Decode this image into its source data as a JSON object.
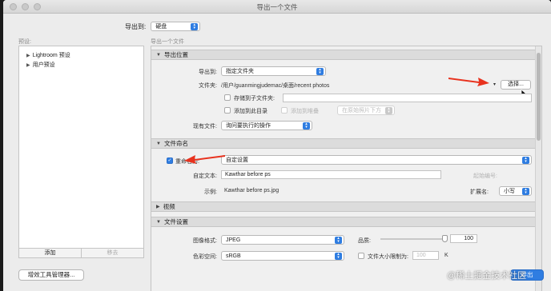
{
  "window": {
    "title": "导出一个文件"
  },
  "export_to": {
    "label": "导出到:",
    "value": "硬盘"
  },
  "presets": {
    "header": "预设:",
    "items": [
      {
        "label": "Lightroom 预设"
      },
      {
        "label": "用户预设"
      }
    ],
    "add_label": "添加",
    "remove_label": "移去"
  },
  "settings_header": "导出一个文件",
  "export_location": {
    "title": "导出位置",
    "export_to_label": "导出到:",
    "export_to_value": "指定文件夹",
    "folder_label": "文件夹:",
    "folder_path": "/用户/guanmingjudemac/桌面/recent photos",
    "choose_button": "选择...",
    "subfolder_label": "存储到子文件夹:",
    "add_to_catalog_label": "添加到此目录",
    "add_to_stack_label": "添加到堆叠",
    "stack_position": "在原始照片下方",
    "existing_files_label": "现有文件:",
    "existing_files_value": "询问要执行的操作"
  },
  "file_naming": {
    "title": "文件命名",
    "rename_label": "重命名为:",
    "rename_value": "自定设置",
    "custom_text_label": "自定文本:",
    "custom_text_value": "Kawthar before ps",
    "start_number_label": "起始编号:",
    "example_label": "示例:",
    "example_value": "Kawthar before ps.jpg",
    "extension_label": "扩展名:",
    "extension_value": "小写"
  },
  "video": {
    "title": "视频"
  },
  "file_settings": {
    "title": "文件设置",
    "format_label": "图像格式:",
    "format_value": "JPEG",
    "quality_label": "品质:",
    "quality_value": "100",
    "color_space_label": "色彩空间:",
    "color_space_value": "sRGB",
    "limit_size_label": "文件大小限制为:",
    "limit_size_value": "100",
    "limit_size_unit": "K"
  },
  "footer": {
    "plugin_manager": "增效工具管理器...",
    "export_button": "导出",
    "watermark": "@稀土掘金技术社区"
  },
  "colors": {
    "accent": "#2f7de1",
    "arrow": "#e8321e"
  }
}
